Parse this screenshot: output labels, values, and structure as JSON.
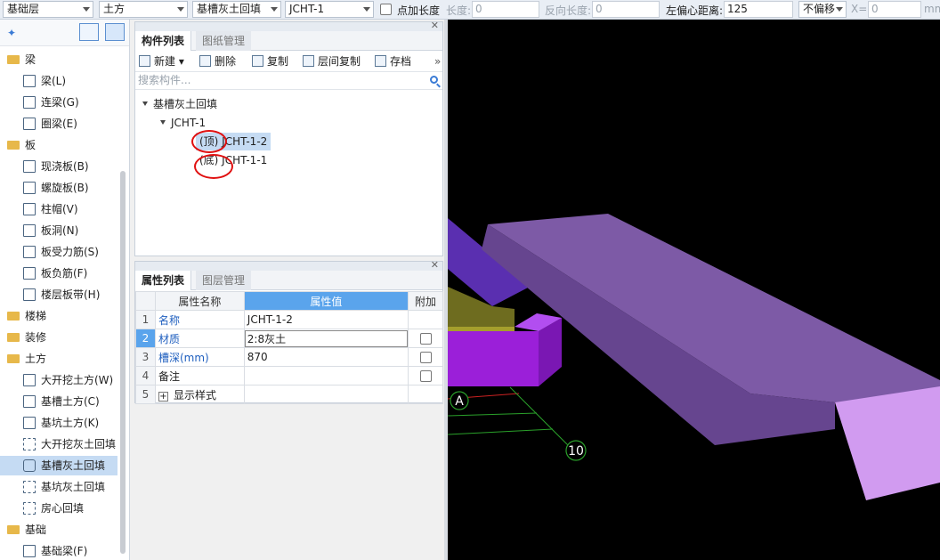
{
  "toolbar": {
    "layer_select": "基础层",
    "category_select": "土方",
    "type_select": "基槽灰土回填",
    "component_select": "JCHT-1",
    "add_length_label": "点加长度",
    "length_label": "长度:",
    "length_value": "0",
    "reverse_length_label": "反向长度:",
    "reverse_length_value": "0",
    "left_offset_label": "左偏心距离:",
    "left_offset_value": "125",
    "offset_select": "不偏移",
    "x_label": "X=",
    "x_value": "0",
    "unit_label": "mm"
  },
  "leftnav": {
    "categories": [
      {
        "label": "梁",
        "items": [
          {
            "label": "梁(L)"
          },
          {
            "label": "连梁(G)"
          },
          {
            "label": "圈梁(E)"
          }
        ]
      },
      {
        "label": "板",
        "items": [
          {
            "label": "现浇板(B)"
          },
          {
            "label": "螺旋板(B)"
          },
          {
            "label": "柱帽(V)"
          },
          {
            "label": "板洞(N)"
          },
          {
            "label": "板受力筋(S)"
          },
          {
            "label": "板负筋(F)"
          },
          {
            "label": "楼层板带(H)"
          }
        ]
      },
      {
        "label": "楼梯",
        "items": []
      },
      {
        "label": "装修",
        "items": []
      },
      {
        "label": "土方",
        "items": [
          {
            "label": "大开挖土方(W)"
          },
          {
            "label": "基槽土方(C)"
          },
          {
            "label": "基坑土方(K)"
          },
          {
            "label": "大开挖灰土回填"
          },
          {
            "label": "基槽灰土回填"
          },
          {
            "label": "基坑灰土回填"
          },
          {
            "label": "房心回填"
          }
        ]
      },
      {
        "label": "基础",
        "items": [
          {
            "label": "基础梁(F)"
          }
        ]
      }
    ]
  },
  "component_panel": {
    "tab_active": "构件列表",
    "tab_inactive": "图纸管理",
    "buttons": {
      "new": "新建",
      "delete": "删除",
      "copy": "复制",
      "floor_copy": "层间复制",
      "archive": "存档"
    },
    "search_placeholder": "搜索构件...",
    "tree": {
      "root": "基槽灰土回填",
      "child": "JCHT-1",
      "leaf1": "(顶) JCHT-1-2",
      "leaf2": "(底) JCHT-1-1"
    }
  },
  "property_panel": {
    "tab_active": "属性列表",
    "tab_inactive": "图层管理",
    "headers": {
      "name": "属性名称",
      "value": "属性值",
      "extra": "附加"
    },
    "rows": [
      {
        "no": "1",
        "name": "名称",
        "value": "JCHT-1-2"
      },
      {
        "no": "2",
        "name": "材质",
        "value": "2:8灰土"
      },
      {
        "no": "3",
        "name": "槽深(mm)",
        "value": "870"
      },
      {
        "no": "4",
        "name": "备注",
        "value": ""
      },
      {
        "no": "5",
        "name": "显示样式",
        "value": ""
      }
    ]
  },
  "viewport": {
    "axis_a": "A",
    "axis_10": "10"
  }
}
